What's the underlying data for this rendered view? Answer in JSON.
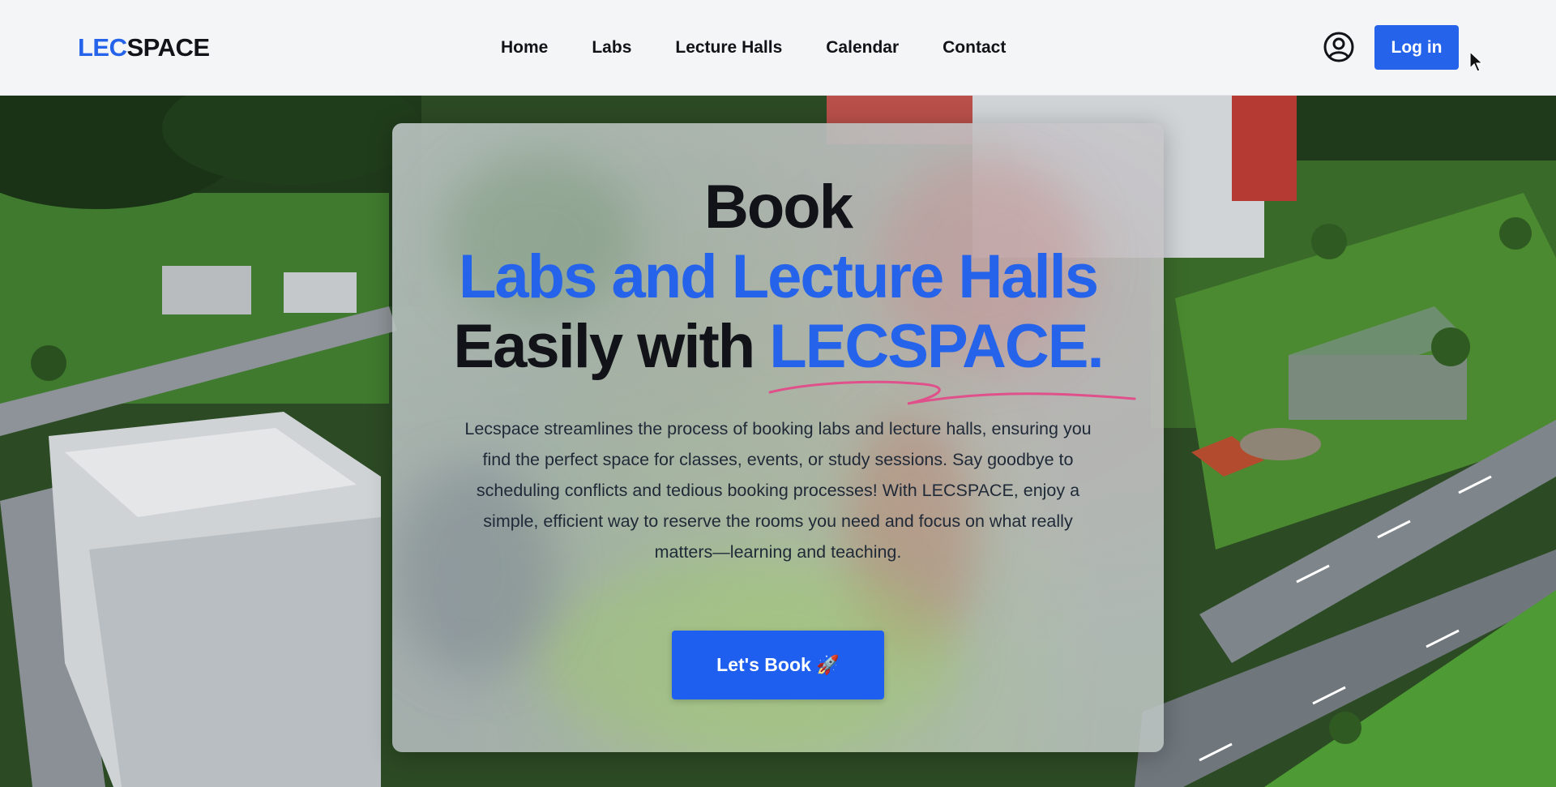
{
  "brand": {
    "logo_accent": "LEC",
    "logo_rest": "SPACE",
    "accent_color": "#2563eb"
  },
  "nav": {
    "links": [
      "Home",
      "Labs",
      "Lecture Halls",
      "Calendar",
      "Contact"
    ],
    "user_icon": "user-circle-icon",
    "login_label": "Log in"
  },
  "hero": {
    "line1": "Book",
    "line2": "Labs and Lecture Halls",
    "line3_prefix": "Easily with ",
    "line3_accent": "LECSPACE.",
    "description": "Lecspace streamlines the process of booking labs and lecture halls, ensuring you find the perfect space for classes, events, or study sessions. Say goodbye to scheduling conflicts and tedious booking processes! With LECSPACE, enjoy a simple, efficient way to reserve the rooms you need and focus on what really matters—learning and teaching.",
    "cta_label": "Let's Book 🚀"
  }
}
